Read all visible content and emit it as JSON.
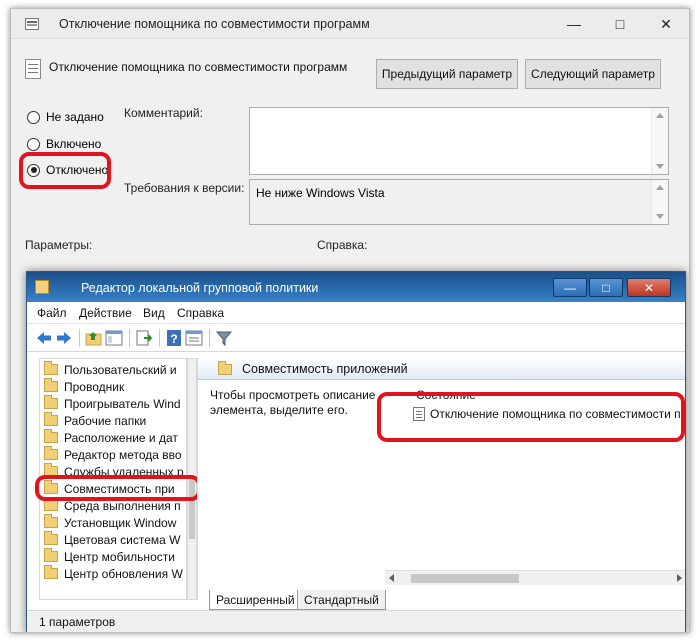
{
  "policy_dialog": {
    "title": "Отключение помощника по совместимости программ",
    "policy_name": "Отключение помощника по совместимости программ",
    "prev_button": "Предыдущий параметр",
    "next_button": "Следующий параметр",
    "radio_options": [
      {
        "label": "Не задано",
        "selected": false
      },
      {
        "label": "Включено",
        "selected": false
      },
      {
        "label": "Отключено",
        "selected": true
      }
    ],
    "comment_label": "Комментарий:",
    "comment_value": "",
    "version_label": "Требования к версии:",
    "version_value": "Не ниже Windows Vista",
    "params_label": "Параметры:",
    "help_label": "Справка:"
  },
  "gpedit": {
    "title": "Редактор локальной групповой политики",
    "menu": [
      "Файл",
      "Действие",
      "Вид",
      "Справка"
    ],
    "tree_items": [
      "Пользовательский и",
      "Проводник",
      "Проигрыватель Wind",
      "Рабочие папки",
      "Расположение и дат",
      "Редактор метода вво",
      "Службы удаленных р",
      "Совместимость при",
      "Среда выполнения п",
      "Установщик Window",
      "Цветовая система W",
      "Центр мобильности",
      "Центр обновления W"
    ],
    "selected_tree_item": "Совместимость при",
    "content_header": "Совместимость приложений",
    "description": "Чтобы просмотреть описание элемента, выделите его.",
    "column_header": "Состояние",
    "setting_item": "Отключение помощника по совместимости прогр",
    "tabs": [
      "Расширенный",
      "Стандартный"
    ],
    "status": "1 параметров"
  },
  "colors": {
    "highlight_red": "#e0141b",
    "title_blue": "#2b6db1"
  },
  "icons": [
    "minimize-icon",
    "maximize-icon",
    "close-icon",
    "back-arrow-icon",
    "forward-arrow-icon",
    "folder-up-icon",
    "show-hide-icon",
    "export-icon",
    "help-icon",
    "properties-icon",
    "filter-icon",
    "policy-icon",
    "folder-icon"
  ]
}
